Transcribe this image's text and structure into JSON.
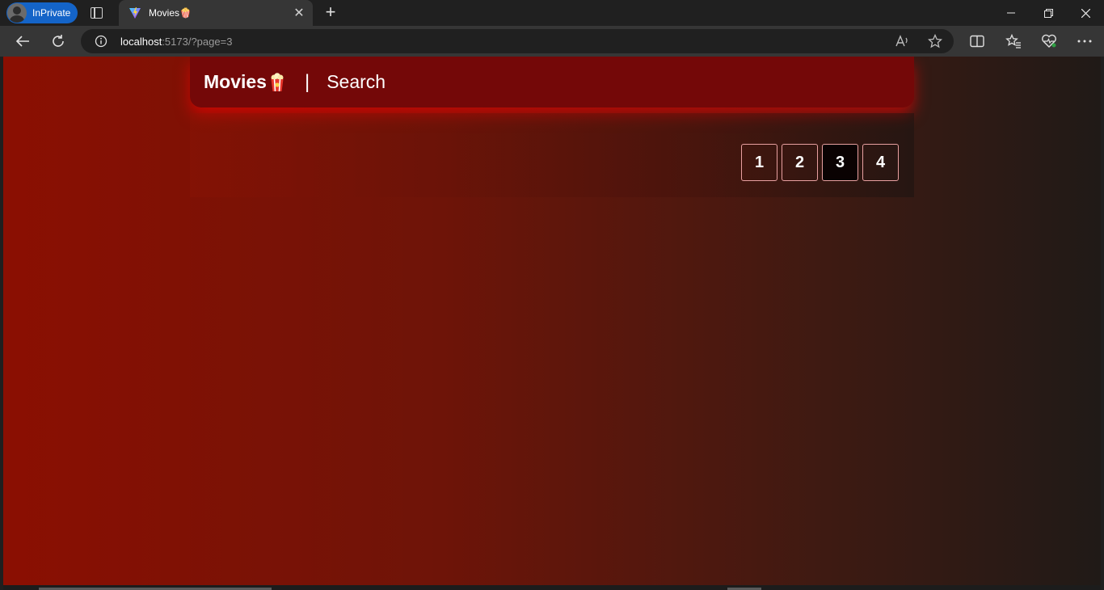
{
  "browser": {
    "inprivate_label": "InPrivate",
    "tab_title": "Movies🍿",
    "url_host": "localhost",
    "url_rest": ":5173/?page=3"
  },
  "site": {
    "brand": "Movies",
    "divider": "|",
    "nav_search": "Search"
  },
  "pagination": {
    "pages": [
      "1",
      "2",
      "3",
      "4"
    ],
    "current": "3"
  },
  "colors": {
    "header_bg": "#740808",
    "header_glow": "#ff0000",
    "page_gradient_start": "#8b0f02",
    "page_gradient_end": "#201a17",
    "page_button_border": "#e8a0a0",
    "active_page_bg": "#0a0202"
  }
}
